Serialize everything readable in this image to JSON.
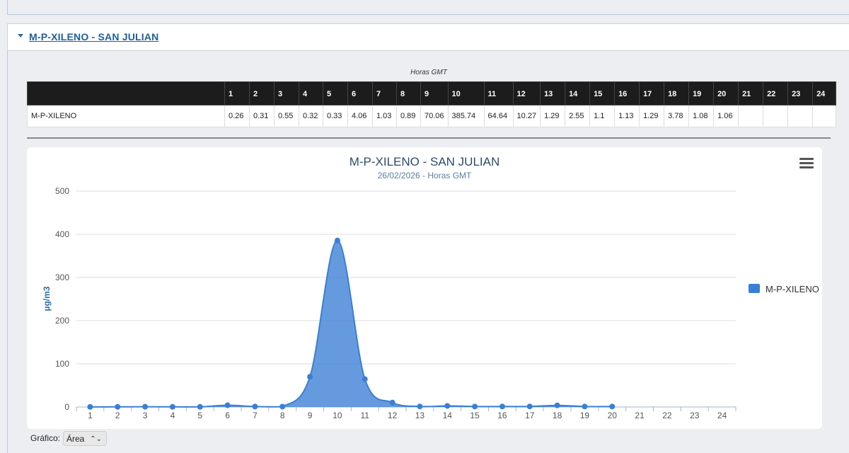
{
  "section": {
    "title": "M-P-XILENO - SAN JULIAN"
  },
  "table": {
    "caption": "Horas GMT",
    "hours": [
      "1",
      "2",
      "3",
      "4",
      "5",
      "6",
      "7",
      "8",
      "9",
      "10",
      "11",
      "12",
      "13",
      "14",
      "15",
      "16",
      "17",
      "18",
      "19",
      "20",
      "21",
      "22",
      "23",
      "24"
    ],
    "row_label": "M-P-XILENO",
    "values": [
      "0.26",
      "0.31",
      "0.55",
      "0.32",
      "0.33",
      "4.06",
      "1.03",
      "0.89",
      "70.06",
      "385.74",
      "64.64",
      "10.27",
      "1.29",
      "2.55",
      "1.1",
      "1.13",
      "1.29",
      "3.78",
      "1.08",
      "1.06",
      "",
      "",
      "",
      ""
    ]
  },
  "chart_data": {
    "type": "area",
    "title": "M-P-XILENO - SAN JULIAN",
    "subtitle": "26/02/2026 - Horas GMT",
    "xlabel": "",
    "ylabel": "µg/m3",
    "categories": [
      "1",
      "2",
      "3",
      "4",
      "5",
      "6",
      "7",
      "8",
      "9",
      "10",
      "11",
      "12",
      "13",
      "14",
      "15",
      "16",
      "17",
      "18",
      "19",
      "20",
      "21",
      "22",
      "23",
      "24"
    ],
    "ylim": [
      0,
      500
    ],
    "yticks": [
      0,
      100,
      200,
      300,
      400,
      500
    ],
    "grid": true,
    "legend_position": "right",
    "series": [
      {
        "name": "M-P-XILENO",
        "color": "#3a7fd5",
        "values": [
          0.26,
          0.31,
          0.55,
          0.32,
          0.33,
          4.06,
          1.03,
          0.89,
          70.06,
          385.74,
          64.64,
          10.27,
          1.29,
          2.55,
          1.1,
          1.13,
          1.29,
          3.78,
          1.08,
          1.06,
          null,
          null,
          null,
          null
        ]
      }
    ]
  },
  "menu": {
    "icon": "hamburger-menu-icon"
  },
  "footer": {
    "label": "Gráfico:",
    "select_value": "Área"
  }
}
